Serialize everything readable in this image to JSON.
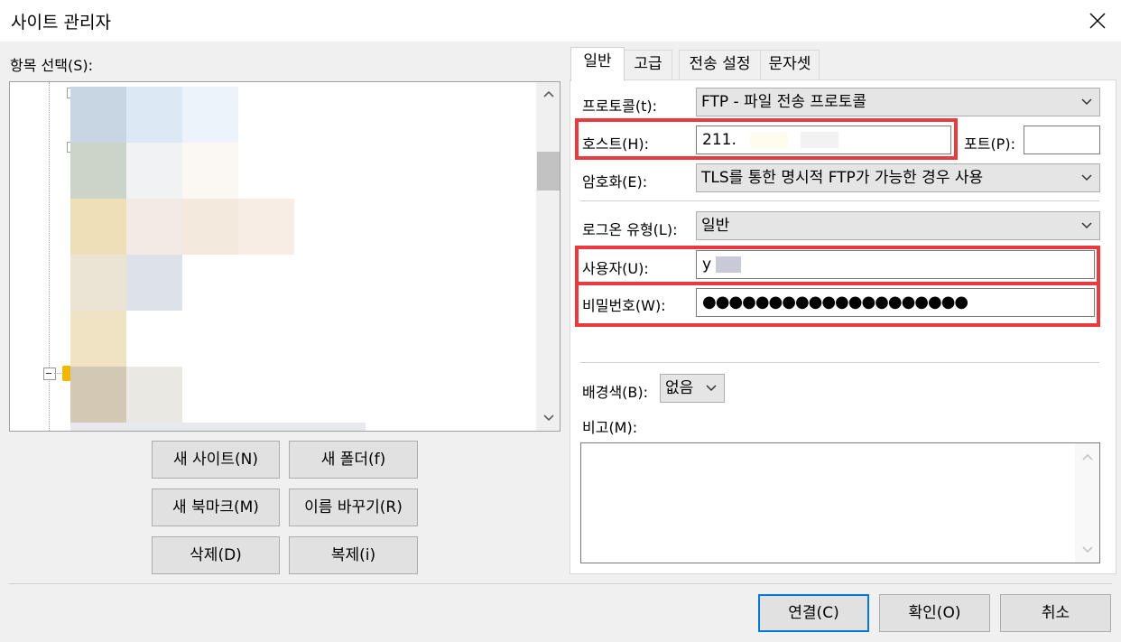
{
  "window": {
    "title": "사이트 관리자"
  },
  "left": {
    "tree_label": "항목 선택(S):",
    "buttons": {
      "new_site": "새 사이트(N)",
      "new_folder": "새 폴더(f)",
      "new_bookmark": "새 북마크(M)",
      "rename": "이름 바꾸기(R)",
      "delete": "삭제(D)",
      "duplicate": "복제(i)"
    }
  },
  "tabs": [
    "일반",
    "고급",
    "전송 설정",
    "문자셋"
  ],
  "general": {
    "protocol_label": "프로토콜(t):",
    "protocol_value": "FTP - 파일 전송 프로토콜",
    "host_label": "호스트(H):",
    "host_value": "211.",
    "port_label": "포트(P):",
    "port_value": "",
    "encryption_label": "암호화(E):",
    "encryption_value": "TLS를 통한 명시적 FTP가 가능한 경우 사용",
    "logon_label": "로그온 유형(L):",
    "logon_value": "일반",
    "user_label": "사용자(U):",
    "user_value": "y",
    "password_label": "비밀번호(W):",
    "password_value": "●●●●●●●●●●●●●●●●●●●●",
    "bgcolor_label": "배경색(B):",
    "bgcolor_value": "없음",
    "comment_label": "비고(M):",
    "comment_value": ""
  },
  "footer": {
    "connect": "연결(C)",
    "ok": "확인(O)",
    "cancel": "취소"
  },
  "colors": {
    "highlight_red": "#e83a3f",
    "focus_blue": "#0078d7"
  }
}
